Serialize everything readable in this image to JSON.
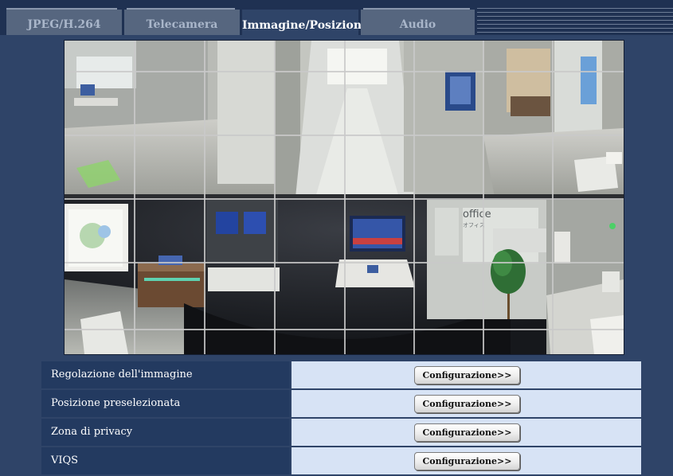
{
  "tabs": [
    {
      "label": "JPEG/H.264",
      "active": false
    },
    {
      "label": "Telecamera",
      "active": false
    },
    {
      "label": "Immagine/Posizione",
      "active": true
    },
    {
      "label": "Audio",
      "active": false
    }
  ],
  "camera_view": {
    "sign_text": "office",
    "sign_subtext": "オフィス"
  },
  "settings": {
    "rows": [
      {
        "label": "Regolazione dell'immagine",
        "button": "Configurazione>>"
      },
      {
        "label": "Posizione preselezionata",
        "button": "Configurazione>>"
      },
      {
        "label": "Zona di privacy",
        "button": "Configurazione>>"
      },
      {
        "label": "VIQS",
        "button": "Configurazione>>"
      }
    ]
  },
  "colors": {
    "panel_bg": "#2f4468",
    "tab_inactive": "#56667f",
    "row_label_bg": "#233a60",
    "row_cell_bg": "#d7e3f5"
  }
}
